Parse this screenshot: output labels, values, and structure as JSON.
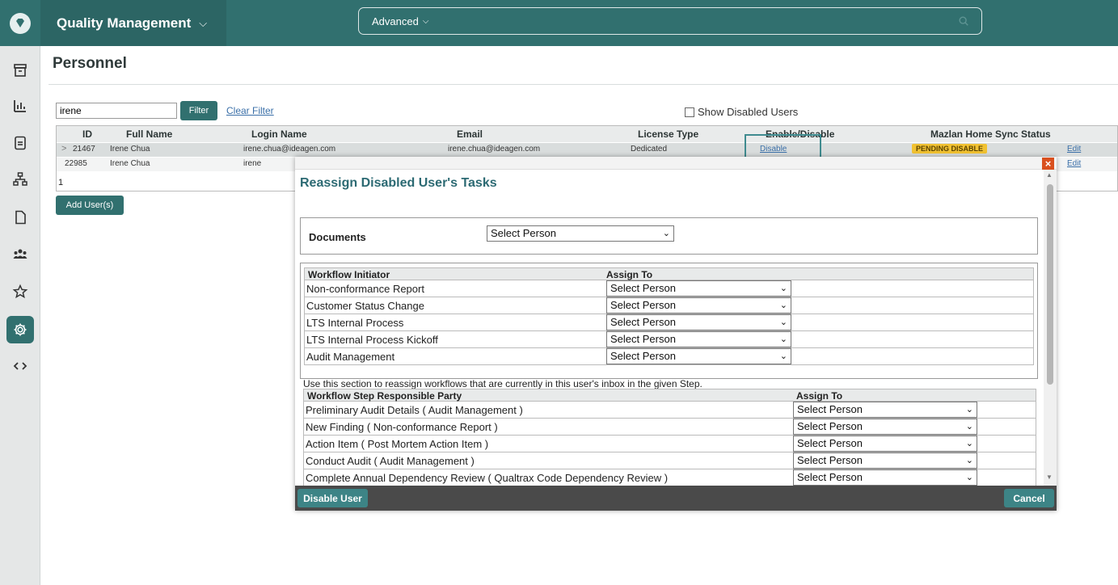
{
  "app": {
    "title": "Quality Management",
    "search_mode": "Advanced"
  },
  "page": {
    "title": "Personnel"
  },
  "filter": {
    "value": "irene",
    "button": "Filter",
    "clear": "Clear Filter",
    "show_disabled": "Show Disabled Users"
  },
  "grid": {
    "columns": [
      "ID",
      "Full Name",
      "Login Name",
      "Email",
      "License Type",
      "Enable/Disable",
      "Mazlan Home Sync Status"
    ],
    "rows": [
      {
        "expander": ">",
        "id": "21467",
        "full_name": "Irene Chua",
        "login": "irene.chua@ideagen.com",
        "email": "irene.chua@ideagen.com",
        "license": "Dedicated",
        "enable": "Disable",
        "sync": "PENDING DISABLE",
        "edit": "Edit"
      },
      {
        "id": "22985",
        "full_name": "Irene Chua",
        "login": "irene",
        "edit": "Edit"
      }
    ],
    "pager": "1"
  },
  "add_users": "Add User(s)",
  "modal": {
    "title": "Reassign Disabled User's Tasks",
    "close": "×",
    "documents_label": "Documents",
    "select_placeholder": "Select Person",
    "workflow_header": {
      "col1": "Workflow Initiator",
      "col2": "Assign To"
    },
    "workflows": [
      "Non-conformance Report",
      "Customer Status Change",
      "LTS Internal Process",
      "LTS Internal Process Kickoff",
      "Audit Management"
    ],
    "step_note": "Use this section to reassign workflows that are currently in this user's inbox in the given Step.",
    "step_header": {
      "col1": "Workflow Step Responsible Party",
      "col2": "Assign To"
    },
    "steps": [
      "Preliminary Audit Details ( Audit Management )",
      "New Finding ( Non-conformance Report )",
      "Action Item ( Post Mortem Action Item )",
      "Conduct Audit ( Audit Management )",
      "Complete Annual Dependency Review ( Qualtrax Code Dependency Review )"
    ],
    "disable_button": "Disable User",
    "cancel_button": "Cancel"
  },
  "colors": {
    "brand": "#31706f",
    "badge": "#f1c232",
    "close": "#d9501f"
  }
}
